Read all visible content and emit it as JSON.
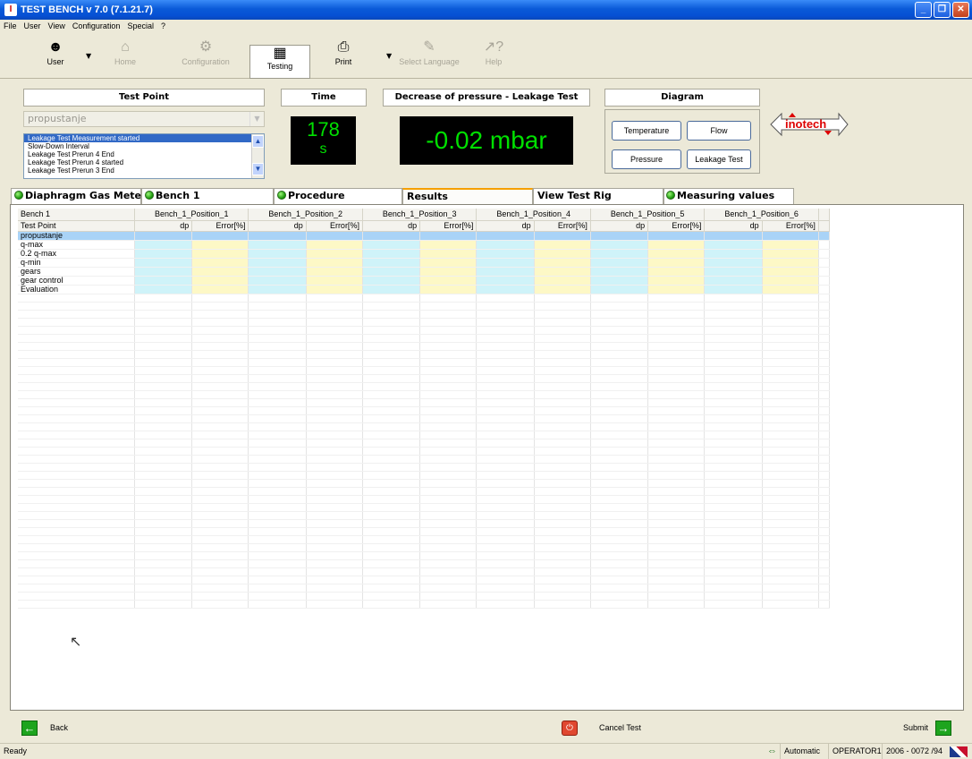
{
  "window": {
    "title": "TEST BENCH v 7.0 (7.1.21.7)",
    "app_icon": "I",
    "minimize": "_",
    "maximize": "❐",
    "close": "✕"
  },
  "menu": [
    "File",
    "User",
    "View",
    "Configuration",
    "Special",
    "?"
  ],
  "toolbar": {
    "user": "User",
    "home": "Home",
    "configuration": "Configuration",
    "testing": "Testing",
    "print": "Print",
    "select_language": "Select Language",
    "help": "Help"
  },
  "header": {
    "test_point_title": "Test Point",
    "test_point_value": "propustanje",
    "time_title": "Time",
    "time_value": "178",
    "time_unit": "s",
    "pressure_title": "Decrease of pressure - Leakage Test",
    "pressure_value": "-0.02 mbar",
    "diagram_title": "Diagram",
    "btn_temperature": "Temperature",
    "btn_flow": "Flow",
    "btn_pressure": "Pressure",
    "btn_leakage_test": "Leakage Test",
    "logo": "inotech",
    "messages": [
      "Leakage Test Measurement started",
      "Slow-Down Interval",
      "Leakage Test Prerun 4 End",
      "Leakage Test Prerun 4 started",
      "Leakage Test Prerun 3 End"
    ]
  },
  "tabs": {
    "diaphragm": "Diaphragm Gas Meter",
    "bench1": "Bench 1",
    "procedure": "Procedure",
    "results": "Results",
    "view_rig": "View Test Rig",
    "measuring": "Measuring values"
  },
  "grid": {
    "bench": "Bench 1",
    "positions": [
      "Bench_1_Position_1",
      "Bench_1_Position_2",
      "Bench_1_Position_3",
      "Bench_1_Position_4",
      "Bench_1_Position_5",
      "Bench_1_Position_6"
    ],
    "test_point_header": "Test Point",
    "dp": "dp",
    "error": "Error[%]",
    "rows": [
      "propustanje",
      "q-max",
      "0.2 q-max",
      "q-min",
      "gears",
      "gear control",
      "Evaluation"
    ]
  },
  "bottom": {
    "back": "Back",
    "cancel": "Cancel Test",
    "submit": "Submit"
  },
  "status": {
    "left": "Ready",
    "mode": "Automatic",
    "operator": "OPERATOR1",
    "id": "2006 - 0072 /94"
  }
}
